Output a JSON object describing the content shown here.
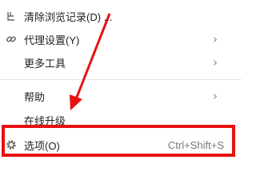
{
  "menu": {
    "items": [
      {
        "label": "清除浏览记录(D) ...",
        "icon": "broom-icon",
        "submenu": false
      },
      {
        "label": "代理设置(Y)",
        "icon": "link-icon",
        "submenu": true
      },
      {
        "label": "更多工具",
        "icon": "",
        "submenu": true
      },
      {
        "label": "帮助",
        "icon": "",
        "submenu": true
      },
      {
        "label": "在线升级",
        "icon": "",
        "submenu": false
      },
      {
        "label": "选项(O)",
        "icon": "gear-icon",
        "shortcut": "Ctrl+Shift+S",
        "submenu": false
      }
    ]
  },
  "annotation": {
    "highlight_color": "#e81010",
    "arrow_color": "#e81010"
  }
}
